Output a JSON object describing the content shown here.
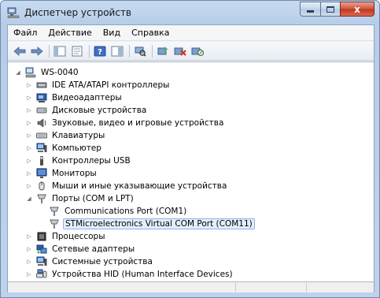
{
  "window": {
    "title": "Диспетчер устройств",
    "close_glyph": "x"
  },
  "menu": [
    "Файл",
    "Действие",
    "Вид",
    "Справка"
  ],
  "toolbar_icons": [
    "back-icon",
    "forward-icon",
    "show-hide-tree-icon",
    "properties-icon",
    "help-icon",
    "action-pane-icon",
    "scan-hardware-icon",
    "update-driver-icon",
    "uninstall-icon",
    "disable-icon"
  ],
  "tree": {
    "root": "WS-0040",
    "items": [
      {
        "label": "IDE ATA/ATAPI контроллеры",
        "icon": "ide-controller-icon",
        "expanded": false
      },
      {
        "label": "Видеоадаптеры",
        "icon": "display-adapter-icon",
        "expanded": false
      },
      {
        "label": "Дисковые устройства",
        "icon": "disk-drive-icon",
        "expanded": false
      },
      {
        "label": "Звуковые, видео и игровые устройства",
        "icon": "sound-icon",
        "expanded": false
      },
      {
        "label": "Клавиатуры",
        "icon": "keyboard-icon",
        "expanded": false
      },
      {
        "label": "Компьютер",
        "icon": "computer-icon",
        "expanded": false
      },
      {
        "label": "Контроллеры USB",
        "icon": "usb-icon",
        "expanded": false
      },
      {
        "label": "Мониторы",
        "icon": "monitor-icon",
        "expanded": false
      },
      {
        "label": "Мыши и иные указывающие устройства",
        "icon": "mouse-icon",
        "expanded": false
      },
      {
        "label": "Порты (COM и LPT)",
        "icon": "port-icon",
        "expanded": true,
        "children": [
          {
            "label": "Communications Port (COM1)",
            "icon": "port-icon",
            "selected": false
          },
          {
            "label": "STMicroelectronics Virtual COM Port (COM11)",
            "icon": "port-icon",
            "selected": true
          }
        ]
      },
      {
        "label": "Процессоры",
        "icon": "processor-icon",
        "expanded": false
      },
      {
        "label": "Сетевые адаптеры",
        "icon": "network-adapter-icon",
        "expanded": false
      },
      {
        "label": "Системные устройства",
        "icon": "system-device-icon",
        "expanded": false
      },
      {
        "label": "Устройства HID (Human Interface Devices)",
        "icon": "hid-icon",
        "expanded": false
      }
    ]
  },
  "colors": {
    "selection_bg": "#e3eefc",
    "selection_border": "#8fb2e6",
    "close_button": "#c2351d"
  }
}
